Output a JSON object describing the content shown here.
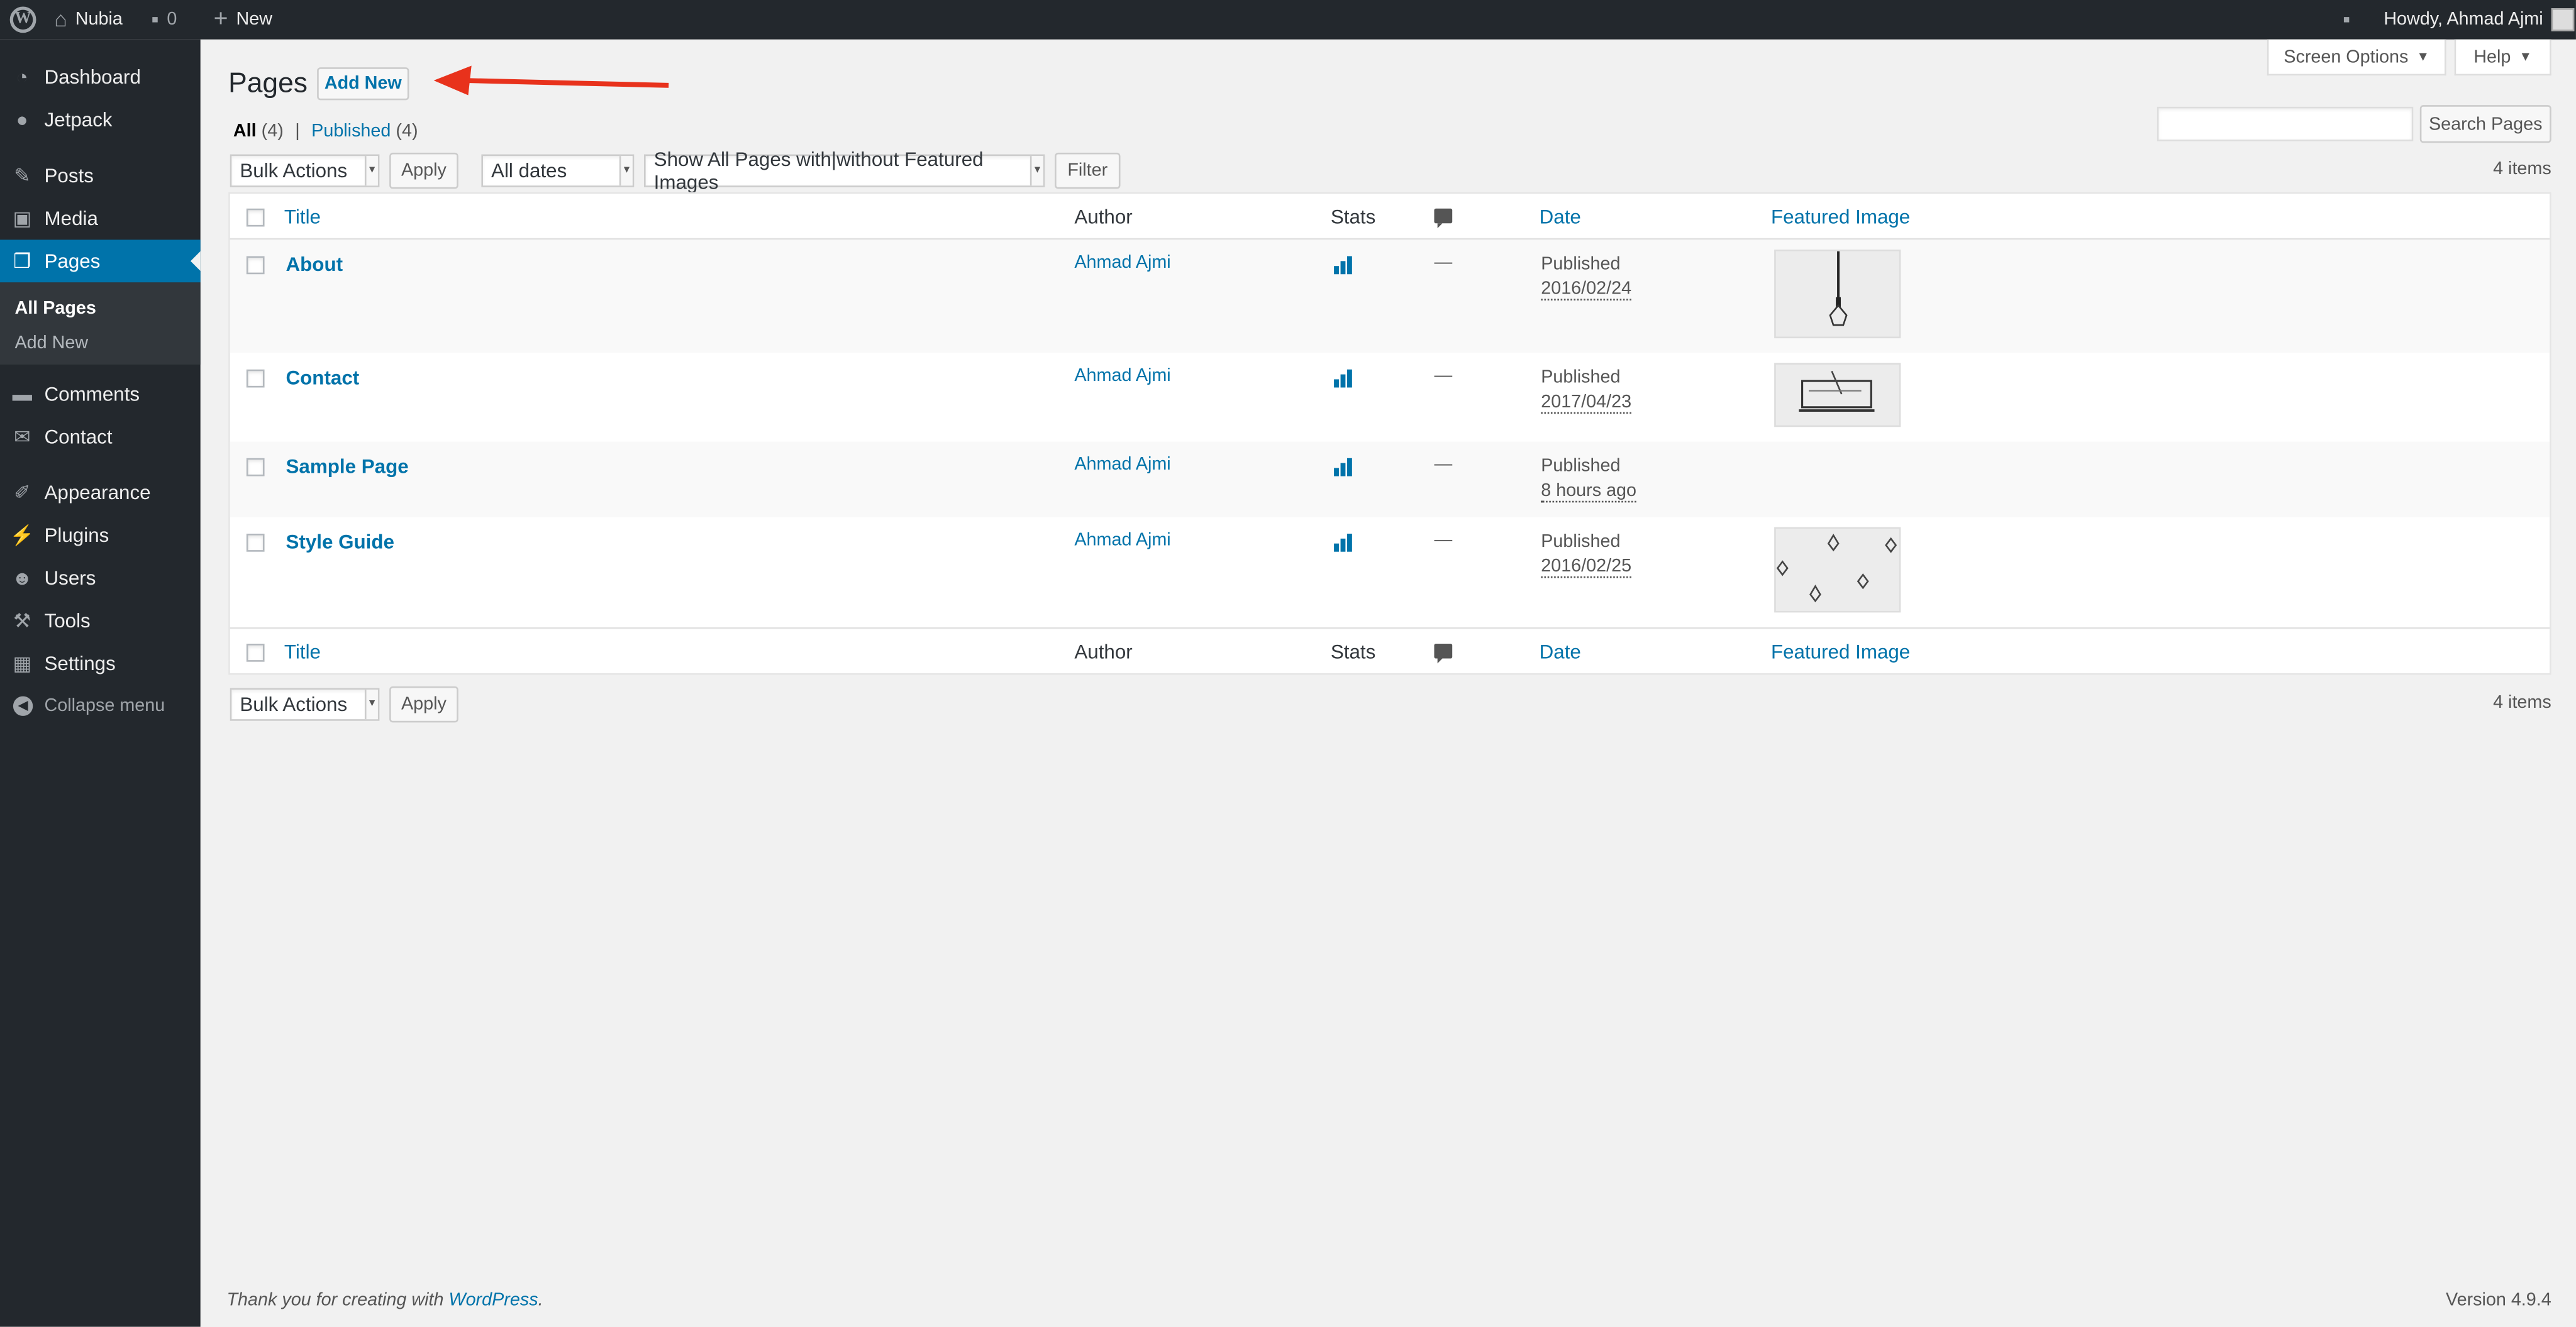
{
  "admin_bar": {
    "site_name": "Nubia",
    "comments_count": "0",
    "new_label": "New",
    "greeting": "Howdy, Ahmad Ajmi"
  },
  "sidebar": {
    "items": [
      {
        "label": "Dashboard",
        "icon": "dashboard-icon"
      },
      {
        "label": "Jetpack",
        "icon": "jetpack-icon"
      },
      {
        "label": "Posts",
        "icon": "pin-icon"
      },
      {
        "label": "Media",
        "icon": "media-icon"
      },
      {
        "label": "Pages",
        "icon": "pages-icon"
      },
      {
        "label": "Comments",
        "icon": "comments-icon"
      },
      {
        "label": "Contact",
        "icon": "mail-icon"
      },
      {
        "label": "Appearance",
        "icon": "brush-icon"
      },
      {
        "label": "Plugins",
        "icon": "plugin-icon"
      },
      {
        "label": "Users",
        "icon": "user-icon"
      },
      {
        "label": "Tools",
        "icon": "wrench-icon"
      },
      {
        "label": "Settings",
        "icon": "settings-icon"
      }
    ],
    "submenu": [
      "All Pages",
      "Add New"
    ],
    "collapse_label": "Collapse menu"
  },
  "screen_options_label": "Screen Options",
  "help_label": "Help",
  "page": {
    "title": "Pages",
    "add_new_label": "Add New"
  },
  "filters": {
    "all_label": "All",
    "all_count": "(4)",
    "separator": "|",
    "published_label": "Published",
    "published_count": "(4)",
    "bulk_actions": "Bulk Actions",
    "apply_label": "Apply",
    "dates": "All dates",
    "featured_filter": "Show All Pages with|without Featured Images",
    "filter_label": "Filter",
    "search_button": "Search Pages",
    "items_count": "4 items"
  },
  "table": {
    "headers": {
      "title": "Title",
      "author": "Author",
      "stats": "Stats",
      "date": "Date",
      "featured_image": "Featured Image"
    },
    "rows": [
      {
        "title": "About",
        "author": "Ahmad Ajmi",
        "comments": "—",
        "status": "Published",
        "date": "2016/02/24",
        "has_image": true
      },
      {
        "title": "Contact",
        "author": "Ahmad Ajmi",
        "comments": "—",
        "status": "Published",
        "date": "2017/04/23",
        "has_image": true
      },
      {
        "title": "Sample Page",
        "author": "Ahmad Ajmi",
        "comments": "—",
        "status": "Published",
        "date": "8 hours ago",
        "has_image": false
      },
      {
        "title": "Style Guide",
        "author": "Ahmad Ajmi",
        "comments": "—",
        "status": "Published",
        "date": "2016/02/25",
        "has_image": true
      }
    ]
  },
  "footer": {
    "thanks_prefix": "Thank you for creating with ",
    "thanks_link": "WordPress",
    "thanks_suffix": ".",
    "version": "Version 4.9.4"
  },
  "colors": {
    "accent": "#0073aa",
    "sidebar_bg": "#23282d",
    "annotation_arrow": "#e8321c"
  }
}
